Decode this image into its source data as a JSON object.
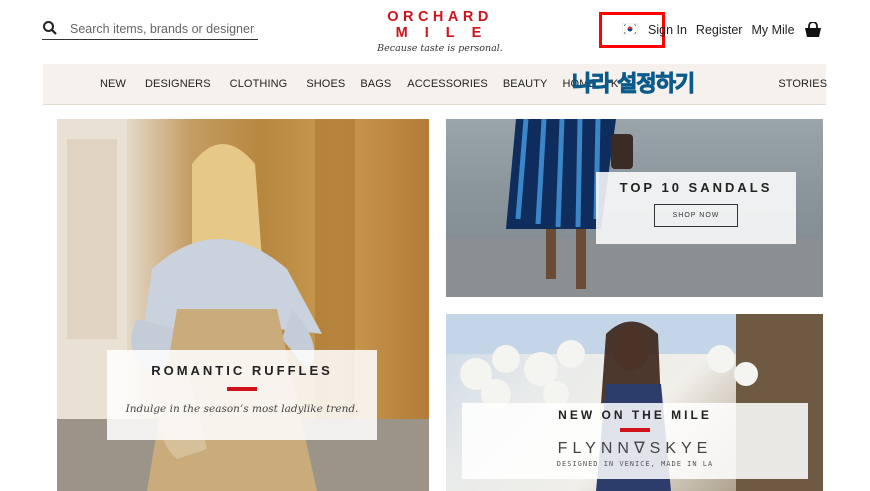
{
  "search": {
    "placeholder": "Search items, brands or designers",
    "icon": "search-icon"
  },
  "logo": {
    "line1": "ORCHARD",
    "line2": "MILE",
    "tagline": "Because taste is personal."
  },
  "account": {
    "sign_in": "Sign In",
    "register": "Register",
    "my_mile": "My Mile",
    "country_flag": "korea-flag-icon",
    "bag_icon": "shopping-bag-icon"
  },
  "annotation": {
    "text": "나라 설정하기",
    "highlight_color": "#ff0000"
  },
  "nav": {
    "items": [
      "NEW",
      "DESIGNERS",
      "CLOTHING",
      "SHOES",
      "BAGS",
      "ACCESSORIES",
      "BEAUTY",
      "HOME",
      "K",
      "STORIES"
    ]
  },
  "tiles": {
    "left": {
      "title": "ROMANTIC RUFFLES",
      "subtitle": "Indulge in the season’s most ladylike trend."
    },
    "top": {
      "title": "TOP 10 SANDALS",
      "button": "SHOP NOW"
    },
    "bottom": {
      "title": "NEW ON THE MILE",
      "brand": "FLYNN∇SKYE",
      "brand_sub": "DESIGNED IN VENICE, MADE IN LA"
    }
  },
  "colors": {
    "brand_red": "#d0121b",
    "nav_bg": "#f6f1ec"
  }
}
